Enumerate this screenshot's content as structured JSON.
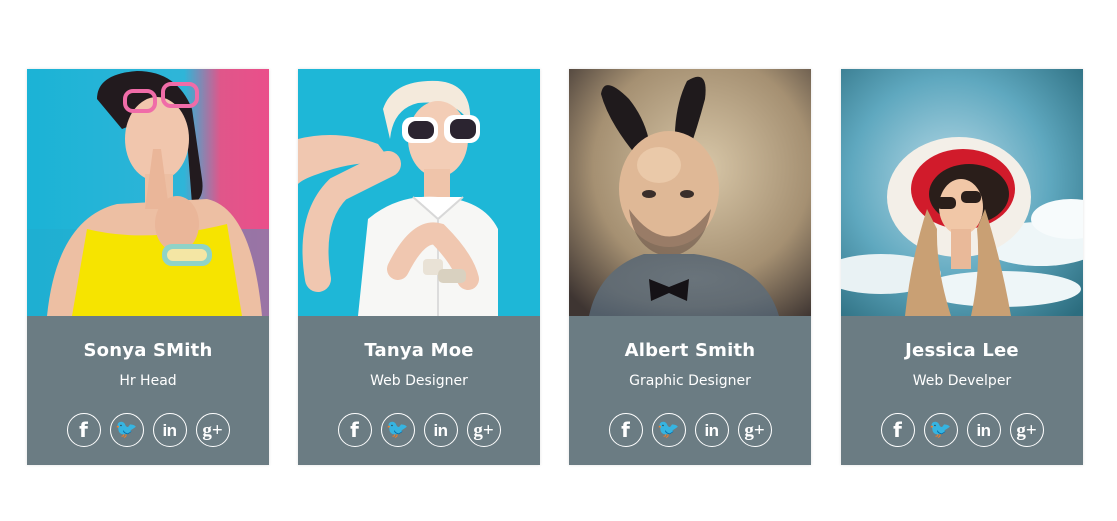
{
  "members": [
    {
      "name": "Sonya SMith",
      "role": "Hr Head",
      "social_icons": [
        "facebook-icon",
        "twitter-icon",
        "linkedin-icon",
        "google-plus-icon"
      ]
    },
    {
      "name": "Tanya Moe",
      "role": "Web Designer",
      "social_icons": [
        "facebook-icon",
        "twitter-icon",
        "linkedin-icon",
        "google-plus-icon"
      ]
    },
    {
      "name": "Albert Smith",
      "role": "Graphic Designer",
      "social_icons": [
        "facebook-icon",
        "twitter-icon",
        "linkedin-icon",
        "google-plus-icon"
      ]
    },
    {
      "name": "Jessica Lee",
      "role": "Web Develper",
      "social_icons": [
        "facebook-icon",
        "twitter-icon",
        "linkedin-icon",
        "google-plus-icon"
      ]
    }
  ],
  "social_glyphs": {
    "facebook": "f",
    "twitter": "🐦",
    "linkedin": "in",
    "googleplus": "g+"
  },
  "colors": {
    "info_background": "#6b7c83",
    "text": "#ffffff"
  }
}
